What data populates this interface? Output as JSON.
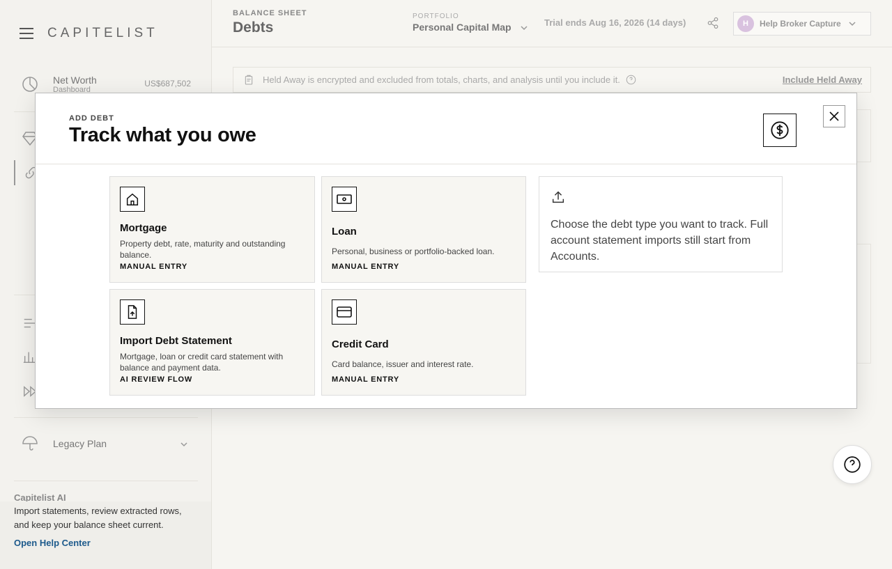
{
  "app": {
    "logo": "CAPITELIST"
  },
  "sidebar": {
    "net_worth": {
      "label": "Net Worth",
      "sub": "Dashboard",
      "value": "US$687,502"
    },
    "legacy_plan": {
      "label": "Legacy Plan"
    },
    "help": {
      "title": "Capitelist AI",
      "description": "Import statements, review extracted rows, and keep your balance sheet current.",
      "link": "Open Help Center"
    }
  },
  "header": {
    "eyebrow": "BALANCE SHEET",
    "title": "Debts",
    "portfolio_label": "PORTFOLIO",
    "portfolio_name": "Personal Capital Map",
    "trial": "Trial ends Aug 16, 2026 (14 days)",
    "user": {
      "initial": "H",
      "name": "Help Broker Capture"
    }
  },
  "banner": {
    "text": "Held Away is encrypted and excluded from totals, charts, and analysis until you include it.",
    "link": "Include Held Away"
  },
  "modal": {
    "eyebrow": "ADD DEBT",
    "title": "Track what you owe",
    "options": [
      {
        "title": "Mortgage",
        "description": "Property debt, rate, maturity and outstanding balance.",
        "tag": "MANUAL ENTRY",
        "icon": "house-icon"
      },
      {
        "title": "Loan",
        "description": "Personal, business or portfolio-backed loan.",
        "tag": "MANUAL ENTRY",
        "icon": "banknote-icon"
      },
      {
        "title": "Import Debt Statement",
        "description": "Mortgage, loan or credit card statement with balance and payment data.",
        "tag": "AI REVIEW FLOW",
        "icon": "file-upload-icon"
      },
      {
        "title": "Credit Card",
        "description": "Card balance, issuer and interest rate.",
        "tag": "MANUAL ENTRY",
        "icon": "credit-card-icon"
      }
    ],
    "info": {
      "text": "Choose the debt type you want to track. Full account statement imports still start from Accounts."
    }
  }
}
